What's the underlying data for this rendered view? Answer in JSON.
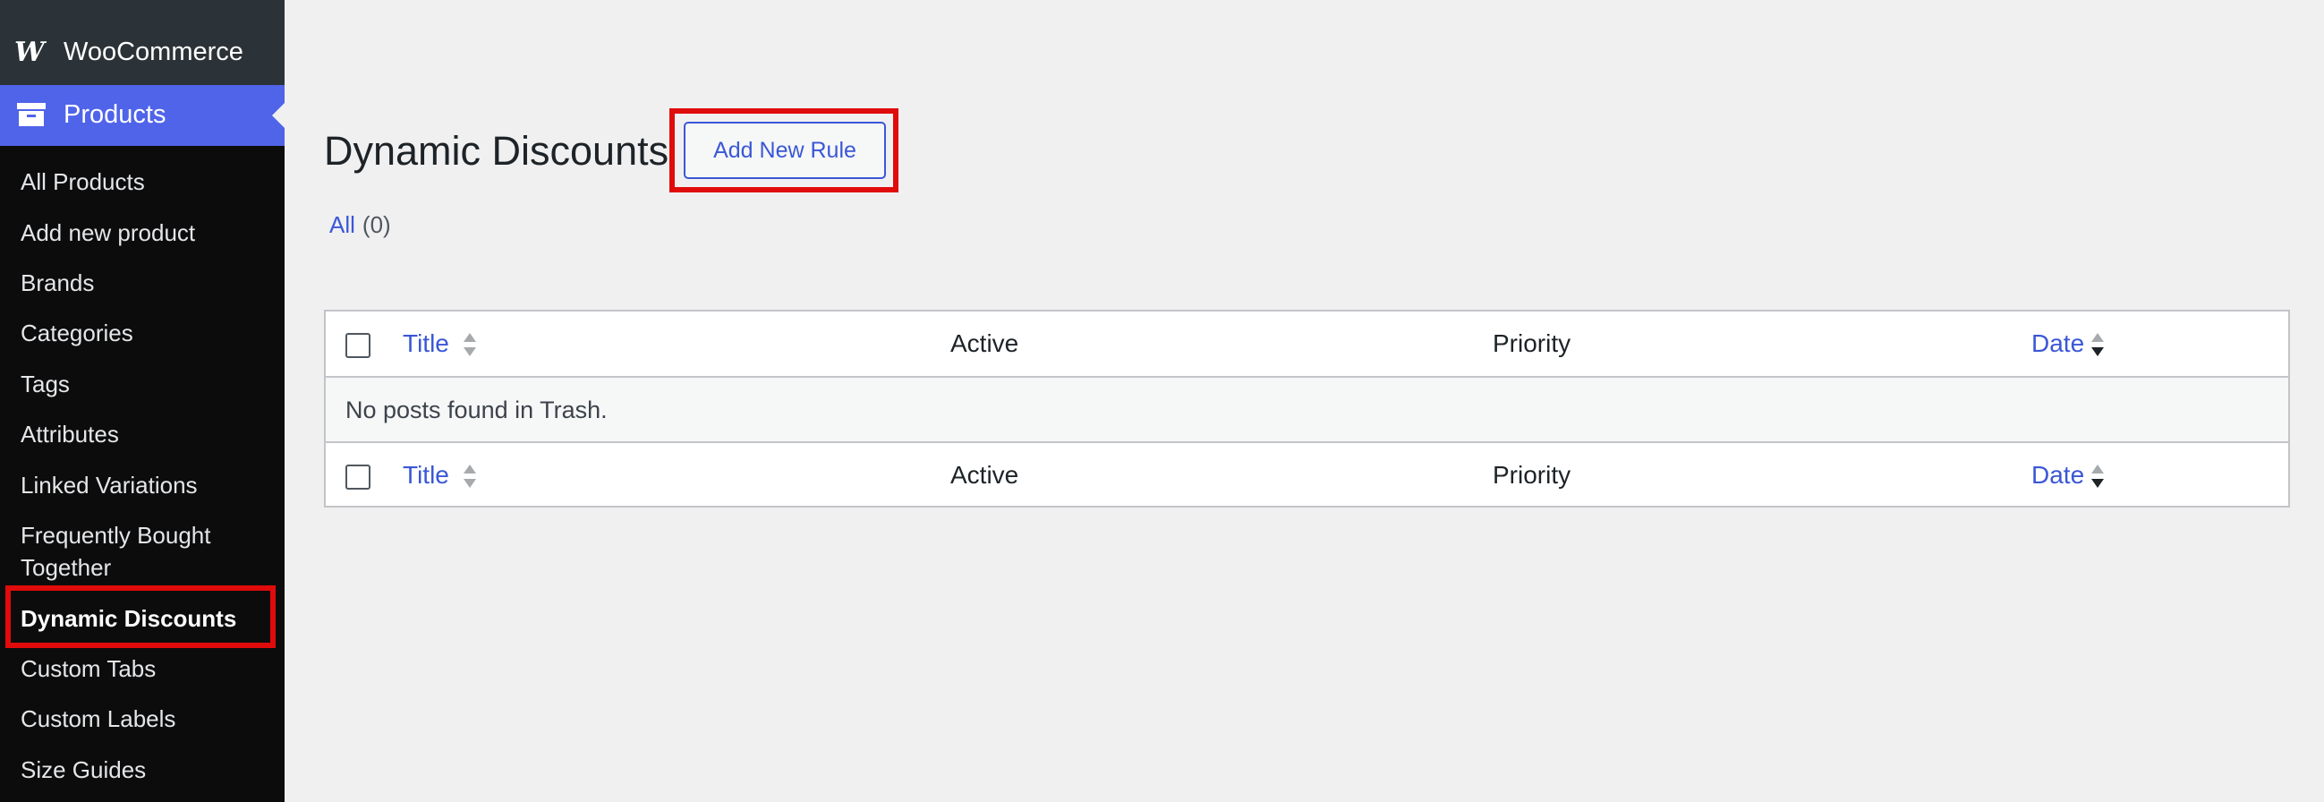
{
  "sidebar": {
    "brand_label": "WooCommerce",
    "brand_icon": "woocommerce-logo-icon",
    "current_menu": {
      "label": "Products",
      "icon": "archive-box-icon"
    },
    "items": [
      {
        "label": "All Products"
      },
      {
        "label": "Add new product"
      },
      {
        "label": "Brands"
      },
      {
        "label": "Categories"
      },
      {
        "label": "Tags"
      },
      {
        "label": "Attributes"
      },
      {
        "label": "Linked Variations"
      },
      {
        "label": "Frequently Bought",
        "label2": "Together"
      },
      {
        "label": "Dynamic Discounts",
        "current": true
      },
      {
        "label": "Custom Tabs"
      },
      {
        "label": "Custom Labels"
      },
      {
        "label": "Size Guides"
      }
    ]
  },
  "page": {
    "title": "Dynamic Discounts",
    "add_button": "Add New Rule",
    "filter": {
      "label": "All",
      "count": "(0)"
    }
  },
  "table": {
    "columns": {
      "title": "Title",
      "active": "Active",
      "priority": "Priority",
      "date": "Date"
    },
    "empty_message": "No posts found in Trash."
  },
  "colors": {
    "accent": "#4f64e9",
    "link": "#3a57d6",
    "highlight": "#e00b0b",
    "sidebar": "#1d2327"
  }
}
